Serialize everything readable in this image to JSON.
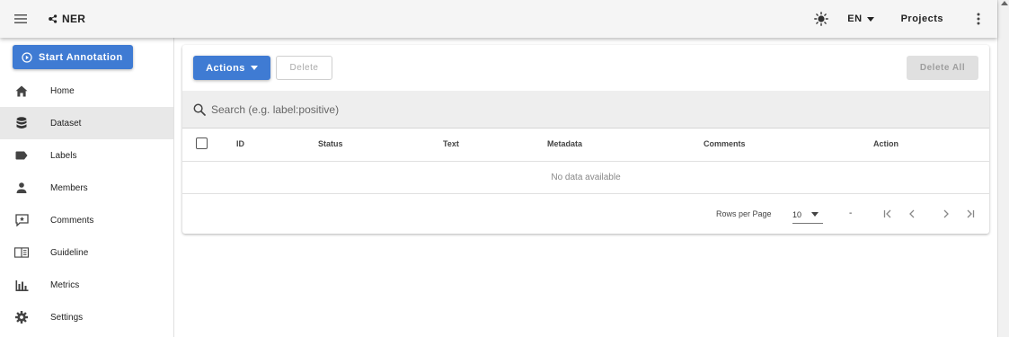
{
  "header": {
    "brand": "NER",
    "language": "EN",
    "projects_label": "Projects"
  },
  "sidebar": {
    "start_button": "Start Annotation",
    "items": [
      {
        "label": "Home",
        "icon": "home-icon"
      },
      {
        "label": "Dataset",
        "icon": "database-icon",
        "active": true
      },
      {
        "label": "Labels",
        "icon": "label-icon"
      },
      {
        "label": "Members",
        "icon": "person-icon"
      },
      {
        "label": "Comments",
        "icon": "comment-icon"
      },
      {
        "label": "Guideline",
        "icon": "book-icon"
      },
      {
        "label": "Metrics",
        "icon": "bar-chart-icon"
      },
      {
        "label": "Settings",
        "icon": "gear-icon"
      }
    ]
  },
  "toolbar": {
    "actions_label": "Actions",
    "delete_label": "Delete",
    "delete_all_label": "Delete All"
  },
  "search": {
    "placeholder": "Search (e.g. label:positive)"
  },
  "table": {
    "columns": [
      "ID",
      "Status",
      "Text",
      "Metadata",
      "Comments",
      "Action"
    ],
    "empty_text": "No data available"
  },
  "pagination": {
    "rows_per_page_label": "Rows per Page",
    "rows_per_page_value": "10",
    "page_text": "-"
  },
  "colors": {
    "primary": "#3f7bd3",
    "appbar": "#f5f5f5",
    "active_nav": "#e8e8e8"
  }
}
